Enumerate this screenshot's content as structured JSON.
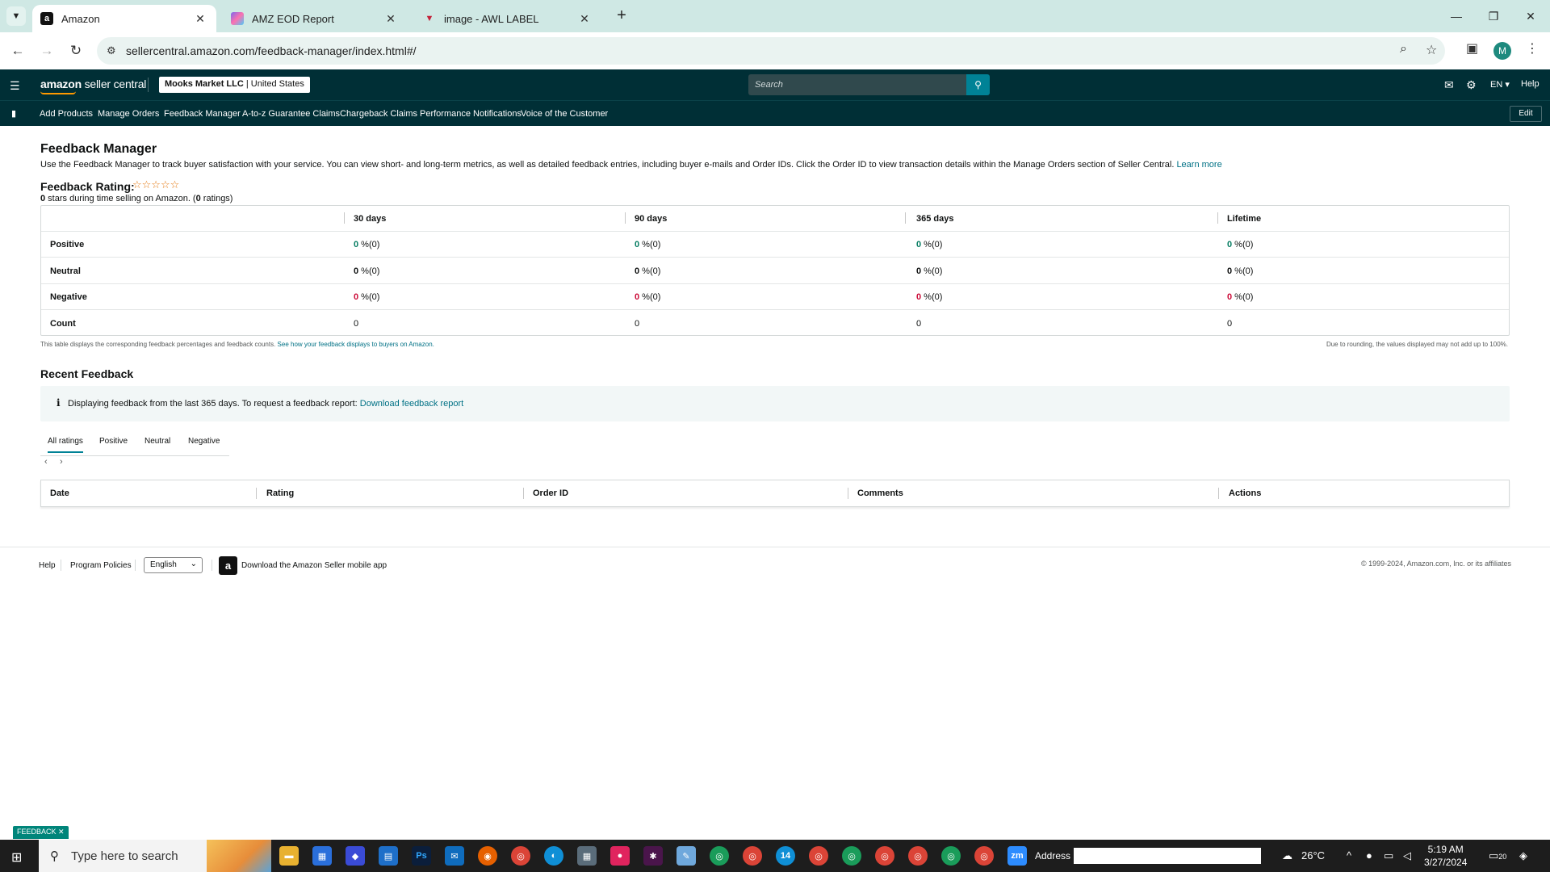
{
  "browser": {
    "tabs": [
      {
        "title": "Amazon",
        "favicon": "amazon-a"
      },
      {
        "title": "AMZ EOD Report",
        "favicon": "clickup"
      },
      {
        "title": "image - AWL LABEL",
        "favicon": "label"
      }
    ],
    "url": "sellercentral.amazon.com/feedback-manager/index.html#/",
    "profile_initial": "M"
  },
  "header": {
    "logo_bold": "amazon",
    "logo_rest": " seller central",
    "account_name": "Mooks Market LLC",
    "account_region": "United States",
    "search_placeholder": "Search",
    "language": "EN",
    "help": "Help"
  },
  "nav": {
    "links": [
      "Add Products",
      "Manage Orders",
      "Feedback Manager",
      "A-to-z Guarantee Claims",
      "Chargeback Claims",
      "Performance Notifications",
      "Voice of the Customer"
    ],
    "edit": "Edit"
  },
  "feedback_manager": {
    "title": "Feedback Manager",
    "intro": "Use the Feedback Manager to track buyer satisfaction with your service. You can view short- and long-term metrics, as well as detailed feedback entries, including buyer e-mails and Order IDs. Click the Order ID to view transaction details within the Manage Orders section of Seller Central.",
    "learn_more": "Learn more",
    "rating_label": "Feedback Rating:",
    "stars": "☆☆☆☆☆",
    "stars_value": "0",
    "stars_text": " stars during time selling on Amazon. (",
    "ratings_count": "0",
    "ratings_text": " ratings)",
    "columns": [
      "30 days",
      "90 days",
      "365 days",
      "Lifetime"
    ],
    "rows": [
      {
        "label": "Positive",
        "values": [
          "0",
          "0",
          "0",
          "0"
        ],
        "suffix": " %(0)"
      },
      {
        "label": "Neutral",
        "values": [
          "0",
          "0",
          "0",
          "0"
        ],
        "suffix": " %(0)"
      },
      {
        "label": "Negative",
        "values": [
          "0",
          "0",
          "0",
          "0"
        ],
        "suffix": " %(0)"
      },
      {
        "label": "Count",
        "values": [
          "0",
          "0",
          "0",
          "0"
        ],
        "suffix": ""
      }
    ],
    "table_note": "This table displays the corresponding feedback percentages and feedback counts.",
    "table_note_link": "See how your feedback displays to buyers on Amazon.",
    "rounding_note": "Due to rounding, the values displayed may not add up to 100%."
  },
  "recent_feedback": {
    "title": "Recent Feedback",
    "info_text": "Displaying feedback from the last 365 days. To request a feedback report:",
    "info_link": "Download feedback report",
    "tabs": [
      "All ratings",
      "Positive",
      "Neutral",
      "Negative"
    ],
    "active_tab": "All ratings",
    "columns": [
      "Date",
      "Rating",
      "Order ID",
      "Comments",
      "Actions"
    ]
  },
  "footer": {
    "help": "Help",
    "policies": "Program Policies",
    "language": "English",
    "app_text": "Download the Amazon Seller mobile app",
    "copyright": "© 1999-2024, Amazon.com, Inc. or its affiliates"
  },
  "feedback_tab": "FEEDBACK",
  "taskbar": {
    "search_placeholder": "Type here to search",
    "address_label": "Address",
    "temperature": "26°C",
    "time": "5:19 AM",
    "date": "3/27/2024",
    "notification_count": "20",
    "badge_count": "14"
  },
  "colors": {
    "header_bg": "#002f36",
    "accent": "#008296",
    "link": "#007185",
    "positive": "#067d62",
    "negative": "#cc0c39",
    "star": "#e47911"
  }
}
